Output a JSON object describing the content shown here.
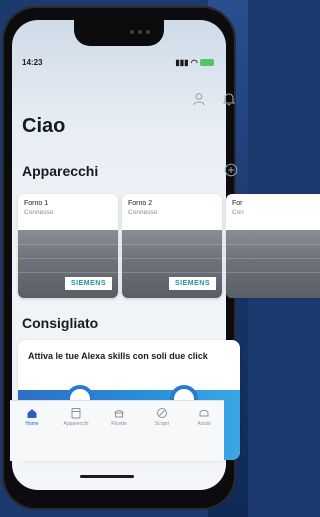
{
  "status": {
    "time": "14:23"
  },
  "header": {
    "greeting": "Ciao"
  },
  "devices": {
    "title": "Apparecchi",
    "items": [
      {
        "name": "Forno 1",
        "status": "Connesso",
        "brand": "SIEMENS"
      },
      {
        "name": "Forno 2",
        "status": "Connesso",
        "brand": "SIEMENS"
      },
      {
        "name": "For",
        "status": "Con",
        "brand": ""
      }
    ]
  },
  "recommended": {
    "title": "Consigliato",
    "promo_text": "Attiva le tue Alexa skills con soli due click"
  },
  "tabs": [
    {
      "label": "Home",
      "icon": "home-icon",
      "active": true
    },
    {
      "label": "Apparecchi",
      "icon": "appliances-icon"
    },
    {
      "label": "Ricette",
      "icon": "recipes-icon"
    },
    {
      "label": "Scopri",
      "icon": "discover-icon"
    },
    {
      "label": "Assist",
      "icon": "assist-icon"
    }
  ],
  "colors": {
    "accent": "#2b62c2",
    "brand_teal": "#1a8fa0",
    "promo_blue": "#2c8fd8"
  }
}
